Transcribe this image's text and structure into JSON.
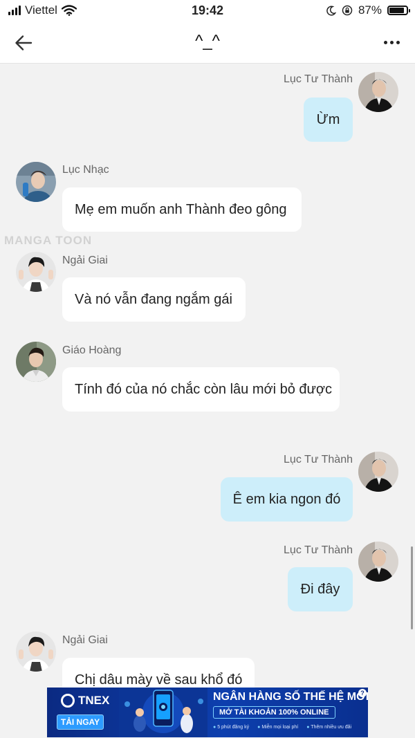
{
  "status_bar": {
    "carrier": "Viettel",
    "time": "19:42",
    "battery_percent": "87%",
    "battery_level": 0.87
  },
  "header": {
    "title": "^_^",
    "back_icon": "arrow-left-icon",
    "more_icon": "more-horizontal-icon"
  },
  "watermark": "MANGA TOON",
  "messages": [
    {
      "sender": "Lục Tư Thành",
      "text": "Ừm",
      "direction": "outgoing"
    },
    {
      "sender": "Lục Nhạc",
      "text": "Mẹ em muốn anh Thành đeo gông",
      "direction": "incoming"
    },
    {
      "sender": "Ngải Giai",
      "text": "Và nó vẫn đang ngắm gái",
      "direction": "incoming"
    },
    {
      "sender": "Giáo Hoàng",
      "text": "Tính đó của nó chắc còn lâu mới bỏ được",
      "direction": "incoming"
    },
    {
      "sender": "Lục Tư Thành",
      "text": "Ê em kia ngon đó",
      "direction": "outgoing"
    },
    {
      "sender": "Lục Tư Thành",
      "text": "Đi đây",
      "direction": "outgoing"
    },
    {
      "sender": "Ngải Giai",
      "text": "Chị dâu mày về sau khổ đó",
      "direction": "incoming"
    }
  ],
  "ad": {
    "brand": "TNEX",
    "cta": "TẢI NGAY",
    "headline": "NGÂN HÀNG SỐ THẾ HỆ MỚI",
    "subline": "MỞ TÀI KHOẢN 100% ONLINE",
    "features": [
      "5 phút đăng ký",
      "Miễn mọi loại phí",
      "Thêm nhiều ưu đãi"
    ],
    "help": "?"
  },
  "colors": {
    "outgoing_bubble": "#cdeefa",
    "incoming_bubble": "#ffffff",
    "background": "#f2f2f2",
    "ad_background": "#0b2a82"
  }
}
